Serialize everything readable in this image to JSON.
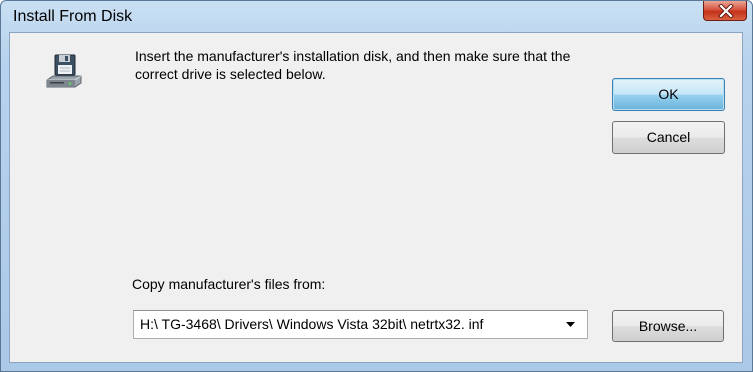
{
  "window": {
    "title": "Install From Disk"
  },
  "dialog": {
    "icon": "floppy-disk-drive-icon",
    "instructions": "Insert the manufacturer's installation disk, and then make sure that the correct drive is selected below.",
    "copy_label": "Copy manufacturer's files from:",
    "path_value": "H:\\ TG-3468\\ Drivers\\ Windows Vista 32bit\\ netrtx32. inf"
  },
  "buttons": {
    "ok": "OK",
    "cancel": "Cancel",
    "browse": "Browse..."
  },
  "colors": {
    "title_bar": "#b7d2ec",
    "client_bg": "#f0f0f0",
    "close_button": "#c3311b",
    "default_button_border": "#3c7fb1"
  }
}
